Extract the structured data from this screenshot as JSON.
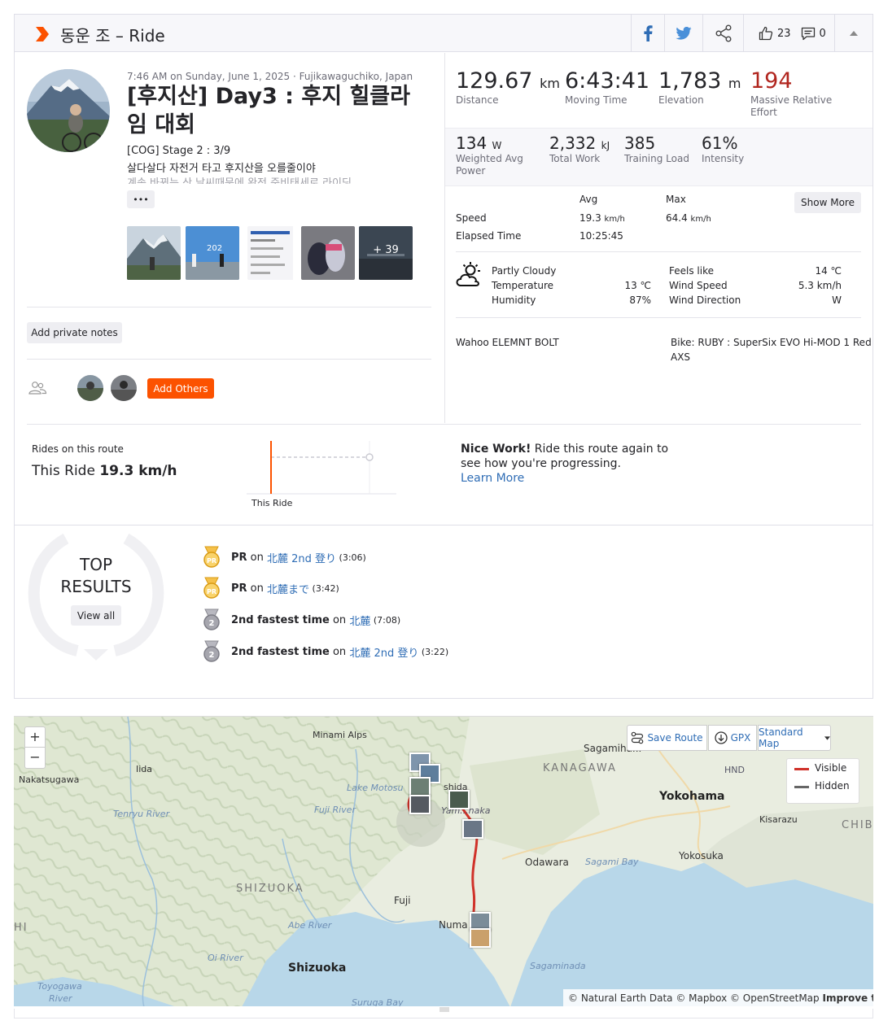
{
  "header": {
    "title": "동운 조 – Ride",
    "kudos_count": "23",
    "comments_count": "0"
  },
  "activity": {
    "datetime_location": "7:46 AM on Sunday, June 1, 2025 · Fujikawaguchiko, Japan",
    "title": "[후지산] Day3 : 후지 힐클라임 대회",
    "description_line1": "[COG] Stage 2 : 3/9",
    "description_line2": "살다살다 자전거 타고 후지산을 오를줄이야",
    "description_line3": "계속 바뀌는 산 날씨때문에 완전 준비태세로 라이딩",
    "more_label": "•••",
    "photos_more": "+ 39",
    "add_private_notes": "Add private notes",
    "add_others": "Add Others"
  },
  "stats": {
    "distance": {
      "value": "129.67",
      "unit": "km",
      "label": "Distance"
    },
    "moving_time": {
      "value": "6:43:41",
      "label": "Moving Time"
    },
    "elevation": {
      "value": "1,783",
      "unit": "m",
      "label": "Elevation"
    },
    "relative_effort": {
      "value": "194",
      "label1": "Massive Relative",
      "label2": "Effort"
    },
    "power": {
      "value": "134",
      "unit": "W",
      "label1": "Weighted Avg",
      "label2": "Power"
    },
    "work": {
      "value": "2,332",
      "unit": "kJ",
      "label": "Total Work"
    },
    "training_load": {
      "value": "385",
      "label": "Training Load"
    },
    "intensity": {
      "value": "61%",
      "label": "Intensity"
    }
  },
  "details": {
    "avg_header": "Avg",
    "max_header": "Max",
    "show_more": "Show More",
    "speed_label": "Speed",
    "speed_avg": "19.3",
    "speed_avg_unit": "km/h",
    "speed_max": "64.4",
    "speed_max_unit": "km/h",
    "elapsed_label": "Elapsed Time",
    "elapsed_value": "10:25:45"
  },
  "weather": {
    "condition": "Partly Cloudy",
    "temperature_label": "Temperature",
    "temperature": "13 ℃",
    "humidity_label": "Humidity",
    "humidity": "87%",
    "feels_like_label": "Feels like",
    "feels_like": "14 ℃",
    "wind_speed_label": "Wind Speed",
    "wind_speed": "5.3 km/h",
    "wind_dir_label": "Wind Direction",
    "wind_dir": "W"
  },
  "gear": {
    "device": "Wahoo ELEMNT BOLT",
    "bike_line1": "Bike: RUBY : SuperSix EVO Hi-MOD 1 Red",
    "bike_line2": "AXS"
  },
  "route": {
    "label": "Rides on this route",
    "this_ride_prefix": "This Ride",
    "this_ride_speed": "19.3 km/h",
    "chart_label": "This Ride",
    "nice_work_bold": "Nice Work!",
    "nice_work_rest": " Ride this route again to",
    "nice_work_line2": "see how you're progressing.",
    "learn_more": "Learn More"
  },
  "top_results": {
    "title1": "TOP",
    "title2": "RESULTS",
    "view_all": "View all",
    "items": [
      {
        "badge": "PR",
        "achievement": "PR",
        "on": " on ",
        "segment": "北麓 2nd 登り",
        "time": " (3:06)"
      },
      {
        "badge": "PR",
        "achievement": "PR",
        "on": " on ",
        "segment": "北麓まで",
        "time": " (3:42)"
      },
      {
        "badge": "2",
        "achievement": "2nd fastest time",
        "on": " on ",
        "segment": "北麓",
        "time": " (7:08)"
      },
      {
        "badge": "2",
        "achievement": "2nd fastest time",
        "on": " on ",
        "segment": "北麓 2nd 登り",
        "time": " (3:22)"
      }
    ]
  },
  "map": {
    "zoom_in": "+",
    "zoom_out": "−",
    "save_route": "Save Route",
    "gpx": "GPX",
    "map_type": "Standard Map",
    "legend_visible": "Visible",
    "legend_hidden": "Hidden",
    "attribution": "© Natural Earth Data © Mapbox © OpenStreetMap",
    "improve": "Improve this map",
    "labels": {
      "minami_alps": "Minami Alps",
      "iida": "Iida",
      "nakatsugawa": "Nakatsugawa",
      "sagamihara": "Sagamiha...",
      "kanagawa": "KANAGAWA",
      "hnd": "HND",
      "yokohama": "Yokohama",
      "kisarazu": "Kisarazu",
      "chib": "CHIB",
      "lake_motosu": "Lake Motosu",
      "fuji_river": "Fuji River",
      "tenryu_river": "Tenryu River",
      "odawara": "Odawara",
      "sagami_bay": "Sagami Bay",
      "yokosuka": "Yokosuka",
      "shizuoka_pref": "SHIZUOKA",
      "fuji": "Fuji",
      "abe_river": "Abe River",
      "numazu": "Numa",
      "oi_river": "Oi River",
      "shizuoka": "Shizuoka",
      "sagaminada": "Sagaminada",
      "toyogawa": "Toyogawa",
      "river": "River",
      "suruga_bay": "Suruga Bay",
      "hi": "HI",
      "shida": "shida",
      "yamanaka": "Yam...naka"
    }
  }
}
